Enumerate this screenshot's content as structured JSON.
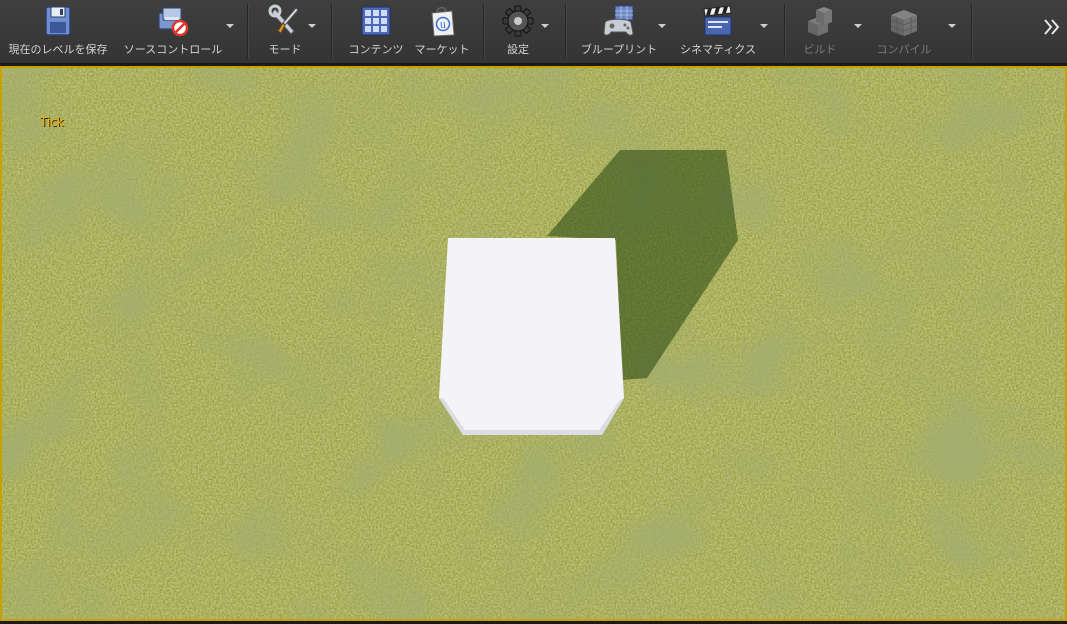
{
  "toolbar": {
    "save_current_level": "現在のレベルを保存",
    "source_control": "ソースコントロール",
    "modes": "モード",
    "content": "コンテンツ",
    "marketplace": "マーケット",
    "settings": "設定",
    "blueprints": "ブループリント",
    "cinematics": "シネマティクス",
    "build": "ビルド",
    "compile": "コンパイル"
  },
  "viewport": {
    "debug_text": "Tick",
    "border_color": "#c8a100",
    "ground_color": "#8f9638",
    "cube_color": "#f4f4f8"
  },
  "icons": {
    "save": "floppy-disk-icon",
    "source_control": "source-control-disabled-icon",
    "modes": "wrench-screwdriver-icon",
    "content": "content-grid-icon",
    "marketplace": "marketplace-bag-icon",
    "settings": "gear-icon",
    "blueprints": "gamepad-icon",
    "cinematics": "clapperboard-icon",
    "build": "build-blocks-icon",
    "compile": "compile-cubes-icon",
    "overflow": "double-chevron-right-icon"
  }
}
